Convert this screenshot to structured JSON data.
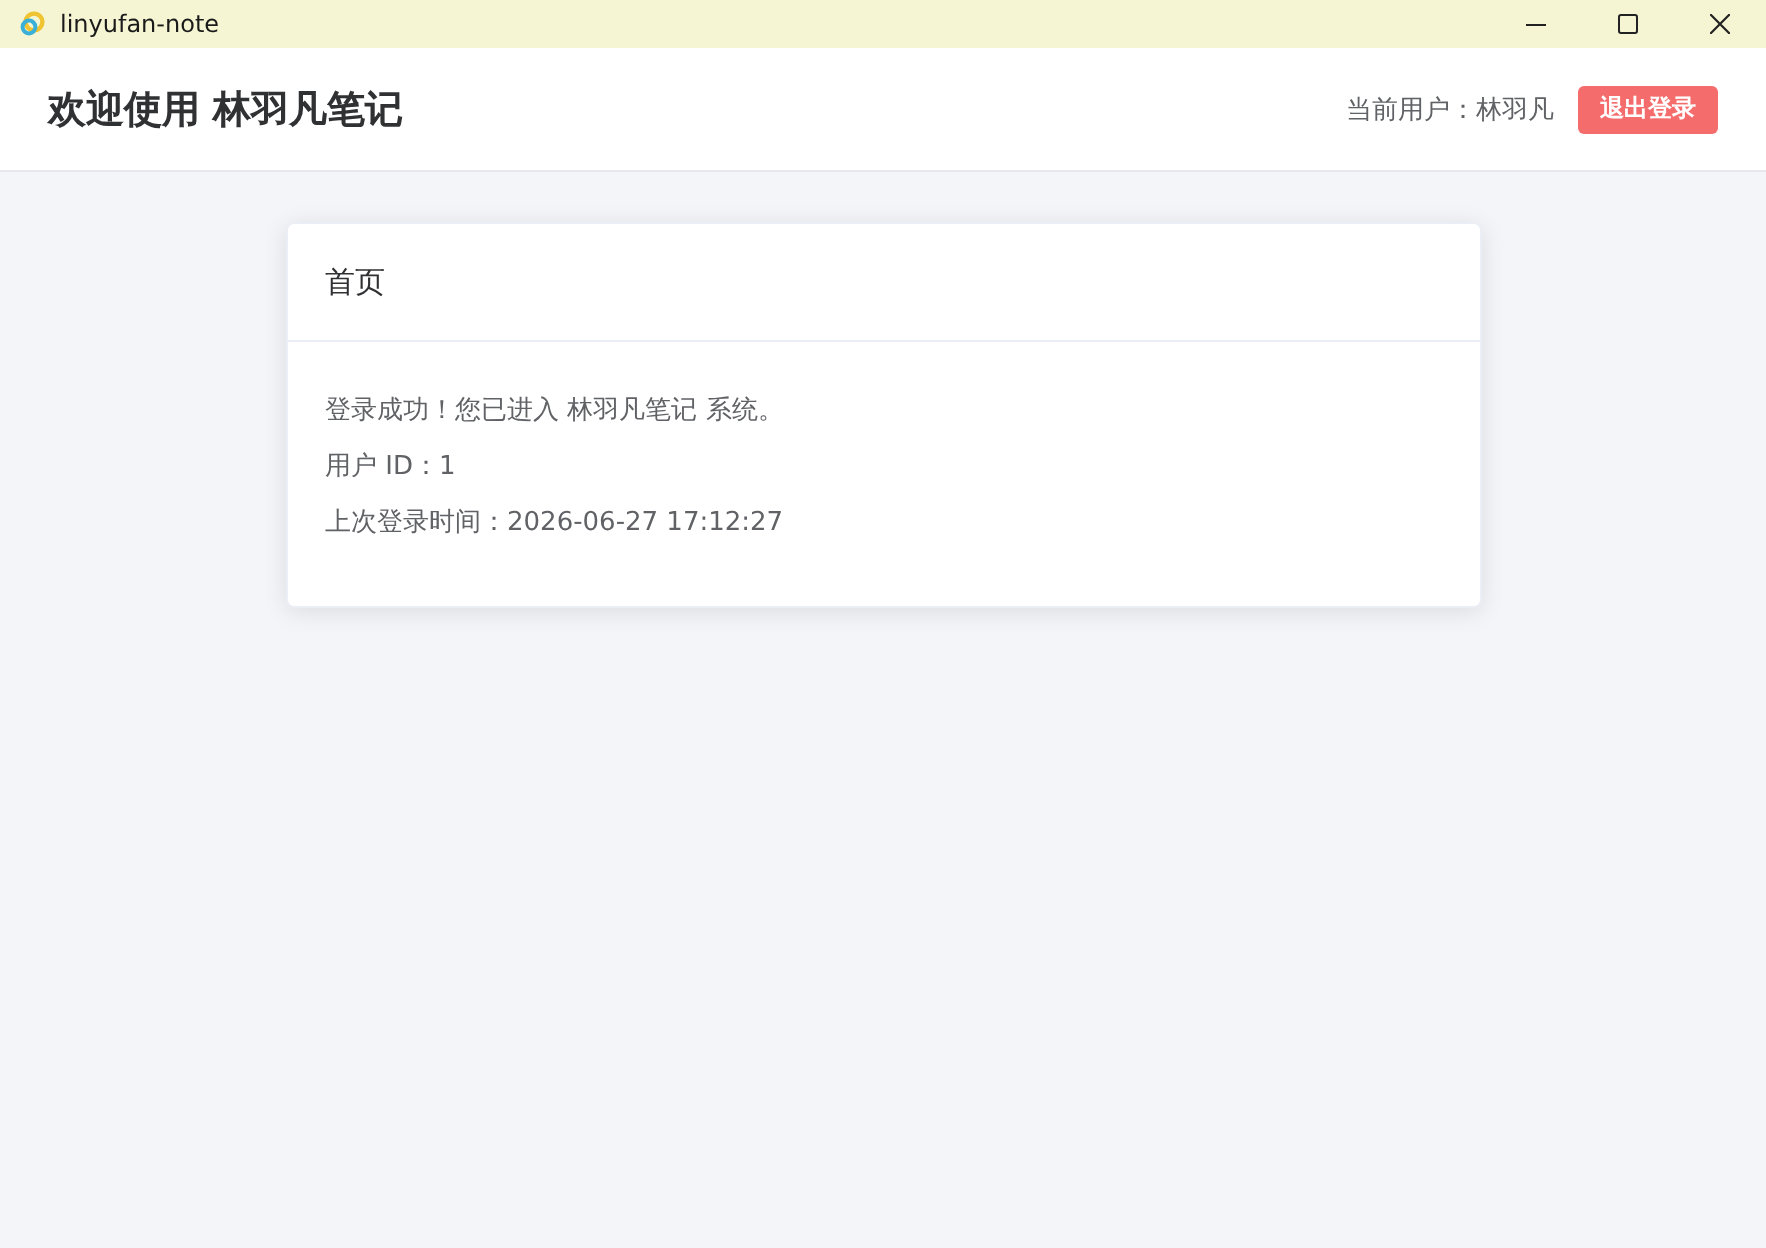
{
  "window": {
    "title": "linyufan-note"
  },
  "header": {
    "title": "欢迎使用 林羽凡笔记",
    "user_label": "当前用户：林羽凡",
    "logout_button": "退出登录"
  },
  "card": {
    "title": "首页",
    "lines": [
      "登录成功！您已进入 林羽凡笔记 系统。",
      "用户 ID：1",
      "上次登录时间：2026-06-27 17:12:27"
    ]
  }
}
